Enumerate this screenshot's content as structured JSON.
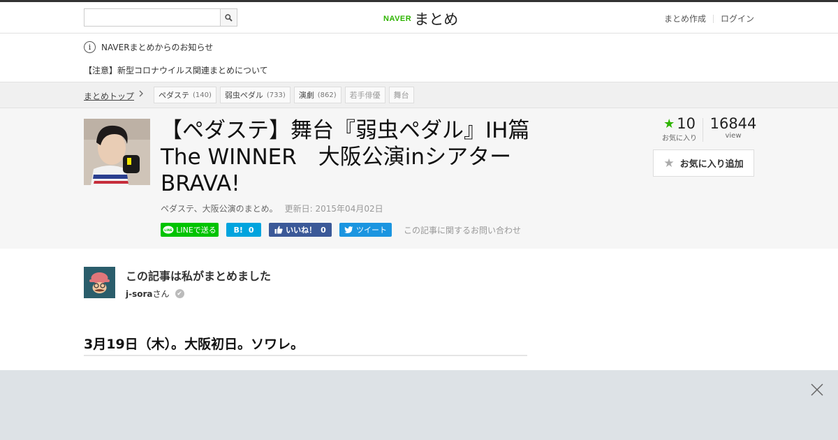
{
  "header": {
    "search_placeholder": "",
    "logo_brand": "NAVER",
    "logo_name": "まとめ",
    "link_create": "まとめ作成",
    "link_login": "ログイン"
  },
  "notice": {
    "title": "NAVERまとめからのお知らせ",
    "item": "【注意】新型コロナウイルス関連まとめについて"
  },
  "breadcrumb": {
    "top": "まとめトップ",
    "tags": [
      {
        "label": "ペダステ",
        "count": "(140)"
      },
      {
        "label": "弱虫ペダル",
        "count": "(733)"
      },
      {
        "label": "演劇",
        "count": "(862)"
      },
      {
        "label": "若手俳優",
        "count": ""
      },
      {
        "label": "舞台",
        "count": ""
      }
    ]
  },
  "article": {
    "title": "【ペダステ】舞台『弱虫ペダル』IH篇The WINNER　大阪公演inシアターBRAVA!",
    "description": "ペダステ、大阪公演のまとめ。",
    "updated": "更新日: 2015年04月02日",
    "favorites_count": "10",
    "favorites_label": "お気に入り",
    "views_count": "16844",
    "views_label": "view",
    "fav_button": "お気に入り追加"
  },
  "share": {
    "line": "LINEで送る",
    "hatena_mark": "B!",
    "hatena_count": "0",
    "fb_label": "いいね！",
    "fb_count": "0",
    "tweet": "ツイート",
    "inquiry": "この記事に関するお問い合わせ"
  },
  "author": {
    "heading": "この記事は私がまとめました",
    "name": "j-sora",
    "suffix": "さん"
  },
  "content": {
    "section_heading": "3月19日（木）。大阪初日。ソワレ。"
  },
  "colors": {
    "naver_green": "#2db400",
    "line_green": "#00c300",
    "hatena_blue": "#00a4de",
    "facebook_blue": "#3b5998",
    "twitter_blue": "#1b95e0"
  }
}
